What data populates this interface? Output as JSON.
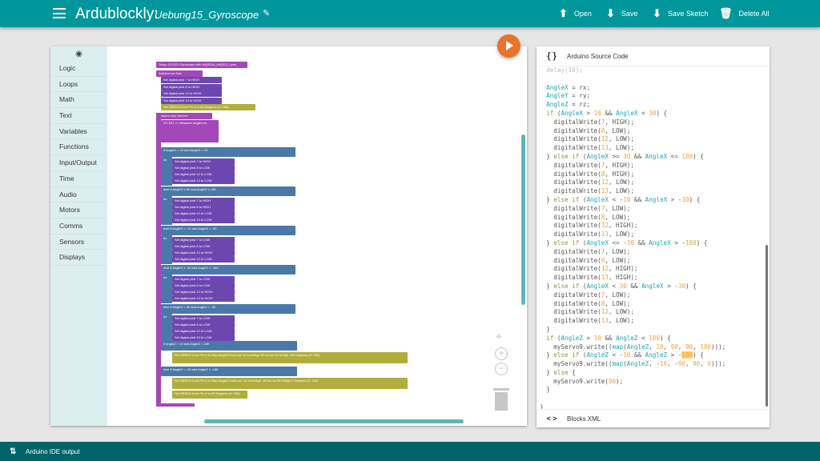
{
  "header": {
    "app_title": "Ardublockly:",
    "sketch_name": "Uebung15_Gyroscope",
    "buttons": [
      {
        "icon": "upload-icon",
        "label": "Open"
      },
      {
        "icon": "download-icon",
        "label": "Save"
      },
      {
        "icon": "download-icon",
        "label": "Save Sketch"
      },
      {
        "icon": "trash-icon",
        "label": "Delete All"
      }
    ]
  },
  "toolbox": {
    "categories": [
      "Logic",
      "Loops",
      "Math",
      "Text",
      "Variables",
      "Functions",
      "Input/Output",
      "Time",
      "Audio",
      "Motors",
      "Comms",
      "Sensors",
      "Displays"
    ]
  },
  "blocks": {
    "setup_gyro": "Setup GY-521 Gyroscope with A4(SDA) | A5(SCL) pins",
    "run_first": "Arduino run first:",
    "setup_pins": [
      {
        "pin": "7",
        "value": "HIGH"
      },
      {
        "pin": "8",
        "value": "HIGH"
      },
      {
        "pin": "12",
        "value": "HIGH"
      },
      {
        "pin": "13",
        "value": "HIGH"
      }
    ],
    "setup_servo": "Set SERVO from Pin 9 to 90 Degrees (0~180)",
    "loop_forever": "Arduino loop forever:",
    "measure": "GY-521 >> Measure angles on",
    "measure_vars": [
      "X: AngleX",
      "Y: AngleY",
      "and Z: AngleZ"
    ],
    "conditions_x": [
      {
        "label": "if",
        "cond": "AngleX > 10 and AngleX < 30",
        "pins": [
          "HIGH",
          "LOW",
          "LOW",
          "LOW"
        ]
      },
      {
        "label": "else if",
        "cond": "AngleX ≥ 30 and AngleX ≤ 180",
        "pins": [
          "HIGH",
          "HIGH",
          "LOW",
          "LOW"
        ]
      },
      {
        "label": "else if",
        "cond": "AngleX < -10 and AngleX > -30",
        "pins": [
          "LOW",
          "LOW",
          "HIGH",
          "LOW"
        ]
      },
      {
        "label": "else if",
        "cond": "AngleX ≤ -30 and AngleX > -180",
        "pins": [
          "LOW",
          "LOW",
          "HIGH",
          "HIGH"
        ]
      },
      {
        "label": "else if",
        "cond": "AngleX < 30 and AngleX > -30",
        "pins": [
          "LOW",
          "LOW",
          "LOW",
          "LOW"
        ]
      }
    ],
    "conditions_z": [
      {
        "label": "if",
        "cond": "AngleZ > 10 and AngleZ < 180",
        "action": "Set SERVO from Pin 9 to Map AngleZ fromLow 10 fromHigh 90 toLow 90 toHigh 180 Degrees (0~180)"
      },
      {
        "label": "else if",
        "cond": "AngleZ < -10 and AngleZ > -180",
        "action": "Set SERVO from Pin 9 to Map AngleZ fromLow -10 fromHigh -90 toLow 90 toHigh 0 Degrees (0~180)"
      },
      {
        "label": "else",
        "action": "Set SERVO from Pin 9 to 90 Degrees (0~180)"
      }
    ]
  },
  "code_panel": {
    "title": "Arduino Source Code",
    "xml_title": "Blocks XML"
  },
  "bottom": {
    "label": "Arduino IDE output"
  }
}
